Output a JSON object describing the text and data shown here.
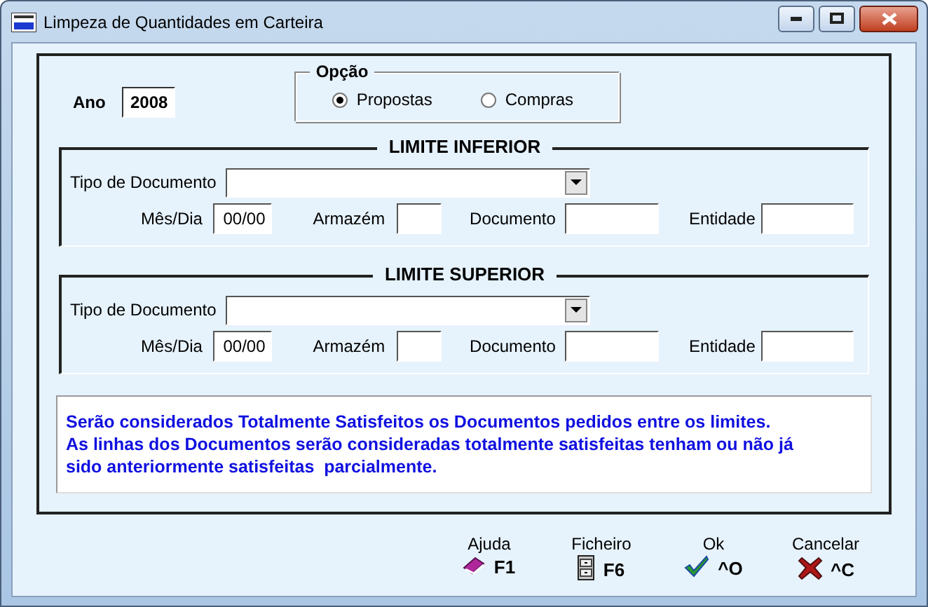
{
  "window": {
    "title": "Limpeza de Quantidades em Carteira"
  },
  "year": {
    "label": "Ano",
    "value": "2008"
  },
  "option": {
    "legend": "Opção",
    "choices": [
      {
        "label": "Propostas",
        "selected": true
      },
      {
        "label": "Compras",
        "selected": false
      }
    ]
  },
  "limits": [
    {
      "title": "LIMITE INFERIOR",
      "document_type": {
        "label": "Tipo de Documento"
      },
      "month_day": {
        "label": "Mês/Dia",
        "value": "00/00"
      },
      "warehouse": {
        "label": "Armazém"
      },
      "document": {
        "label": "Documento"
      },
      "entity": {
        "label": "Entidade"
      }
    },
    {
      "title": "LIMITE SUPERIOR",
      "document_type": {
        "label": "Tipo de Documento"
      },
      "month_day": {
        "label": "Mês/Dia",
        "value": "00/00"
      },
      "warehouse": {
        "label": "Armazém"
      },
      "document": {
        "label": "Documento"
      },
      "entity": {
        "label": "Entidade"
      }
    }
  ],
  "message": "Serão considerados Totalmente Satisfeitos os Documentos pedidos entre os limites.\nAs linhas dos Documentos serão consideradas totalmente satisfeitas tenham ou não já\nsido anteriormente satisfeitas  parcialmente.",
  "buttons": [
    {
      "kind": "help",
      "label": "Ajuda",
      "key": "F1"
    },
    {
      "kind": "file",
      "label": "Ficheiro",
      "key": "F6"
    },
    {
      "kind": "ok",
      "label": "Ok",
      "key": "^O"
    },
    {
      "kind": "cancel",
      "label": "Cancelar",
      "key": "^C"
    }
  ]
}
